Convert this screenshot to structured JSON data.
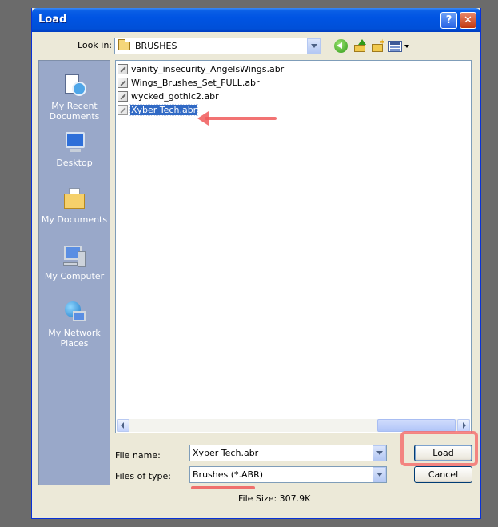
{
  "window": {
    "title": "Load",
    "help_glyph": "?",
    "close_glyph": "✕"
  },
  "look_in": {
    "label": "Look in:",
    "value": "BRUSHES"
  },
  "places": [
    {
      "label_line1": "My Recent",
      "label_line2": "Documents",
      "icon": "recent-documents-icon"
    },
    {
      "label_line1": "Desktop",
      "label_line2": "",
      "icon": "desktop-icon"
    },
    {
      "label_line1": "My Documents",
      "label_line2": "",
      "icon": "my-documents-icon"
    },
    {
      "label_line1": "My Computer",
      "label_line2": "",
      "icon": "my-computer-icon"
    },
    {
      "label_line1": "My Network",
      "label_line2": "Places",
      "icon": "network-places-icon"
    }
  ],
  "files": [
    {
      "name": "vanity_insecurity_AngelsWings.abr",
      "selected": false
    },
    {
      "name": "Wings_Brushes_Set_FULL.abr",
      "selected": false
    },
    {
      "name": "wycked_gothic2.abr",
      "selected": false
    },
    {
      "name": "Xyber Tech.abr",
      "selected": true
    }
  ],
  "form": {
    "file_name_label": "File name:",
    "file_name_value": "Xyber Tech.abr",
    "file_type_label": "Files of type:",
    "file_type_value": "Brushes (*.ABR)"
  },
  "buttons": {
    "load": "Load",
    "cancel": "Cancel"
  },
  "status": {
    "file_size": "File Size: 307.9K"
  },
  "colors": {
    "title_bar": "#0054e3",
    "selection": "#316ac5",
    "annotation": "#f05a5a"
  }
}
